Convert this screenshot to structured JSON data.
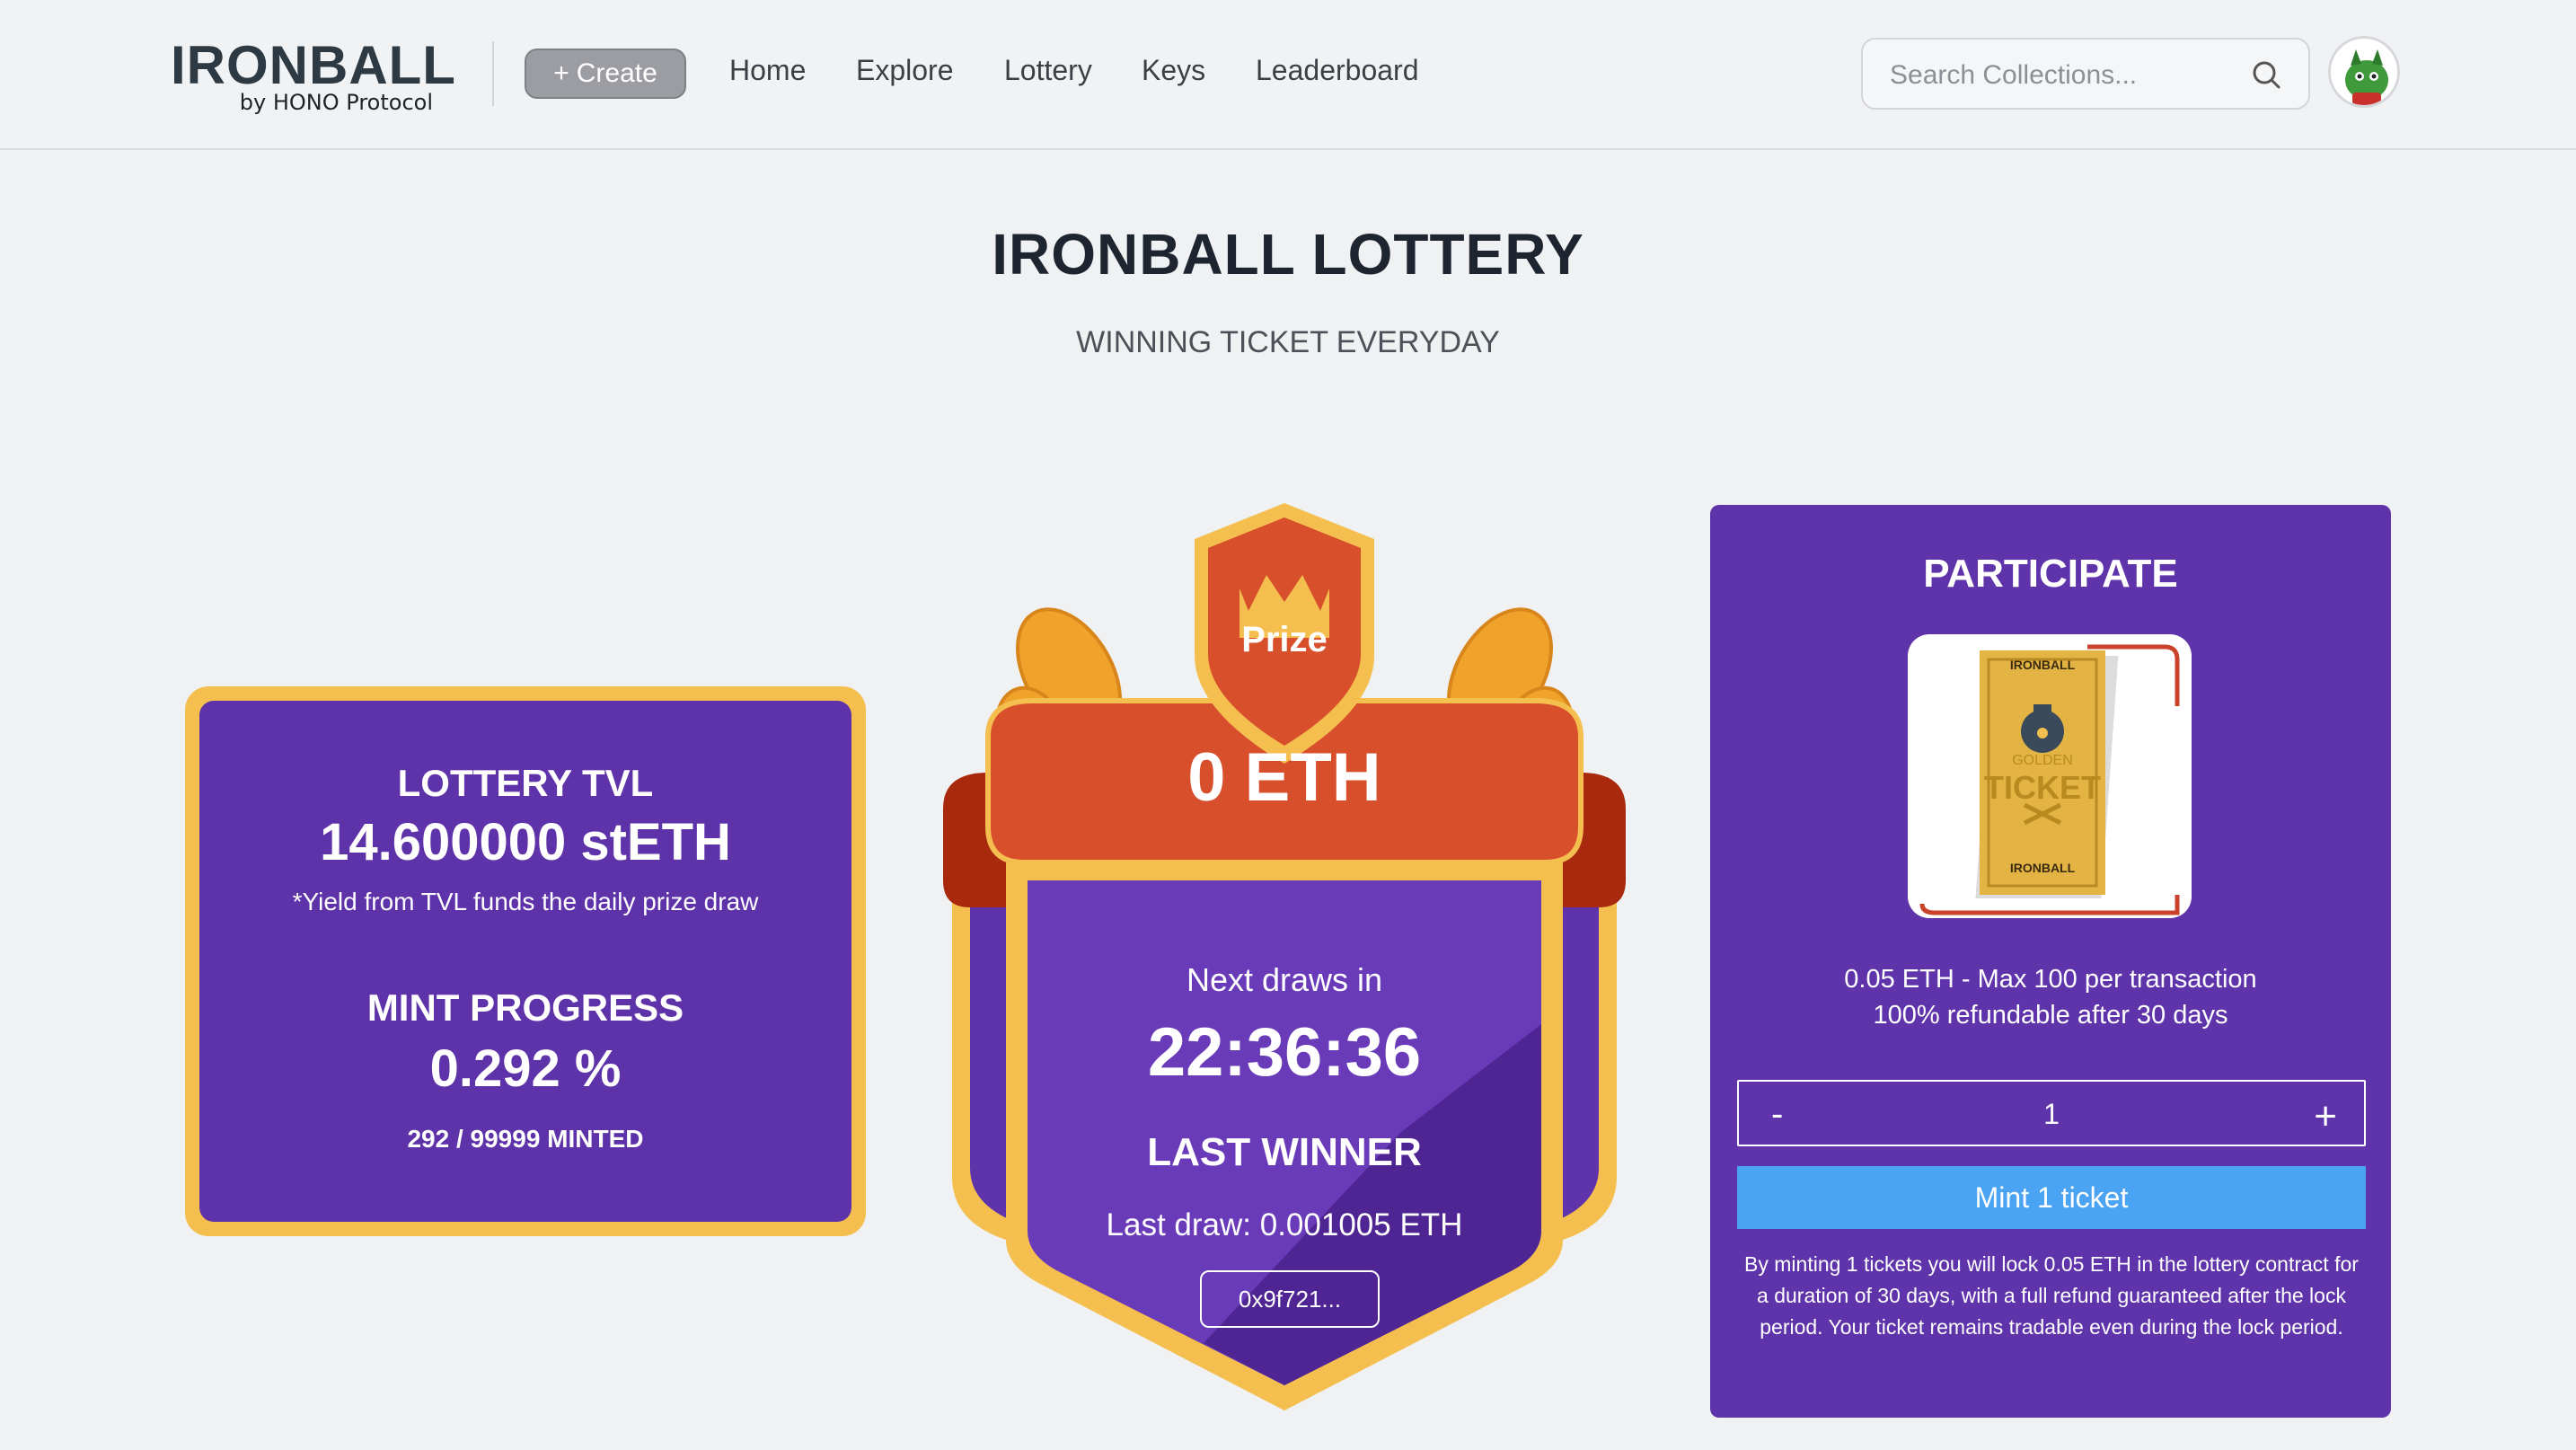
{
  "nav": {
    "logo_title": "IRONBALL",
    "logo_sub": "by HONO Protocol",
    "create_label": "Create",
    "links": [
      "Home",
      "Explore",
      "Lottery",
      "Keys",
      "Leaderboard"
    ],
    "search_placeholder": "Search Collections..."
  },
  "page": {
    "title": "IRONBALL LOTTERY",
    "subtitle": "WINNING TICKET EVERYDAY"
  },
  "tvl": {
    "label": "LOTTERY TVL",
    "value": "14.600000 stETH",
    "note": "*Yield from TVL funds the daily prize draw",
    "mint_label": "MINT PROGRESS",
    "mint_value": "0.292 %",
    "minted": "292 / 99999 MINTED"
  },
  "prize": {
    "label": "Prize",
    "amount": "0 ETH",
    "next_label": "Next draws in",
    "countdown": "22:36:36",
    "last_winner_label": "LAST WINNER",
    "last_draw": "Last draw: 0.001005 ETH",
    "winner_address": "0x9f721..."
  },
  "participate": {
    "title": "PARTICIPATE",
    "ticket_brand": "IRONBALL",
    "ticket_golden": "GOLDEN",
    "ticket_word": "TICKET",
    "price_line": "0.05 ETH - Max 100 per transaction",
    "refund_line": "100% refundable after 30 days",
    "minus": "-",
    "quantity": "1",
    "plus": "+",
    "mint_button": "Mint 1 ticket",
    "note": "By minting 1 tickets you will lock 0.05 ETH in the lottery contract for a duration of 30 days, with a full refund guaranteed after the lock period. Your ticket remains tradable even during the lock period."
  },
  "colors": {
    "purple": "#5f33aa",
    "gold": "#f4bf4f",
    "orange_red": "#d9502f",
    "blue": "#4ba3f4"
  }
}
